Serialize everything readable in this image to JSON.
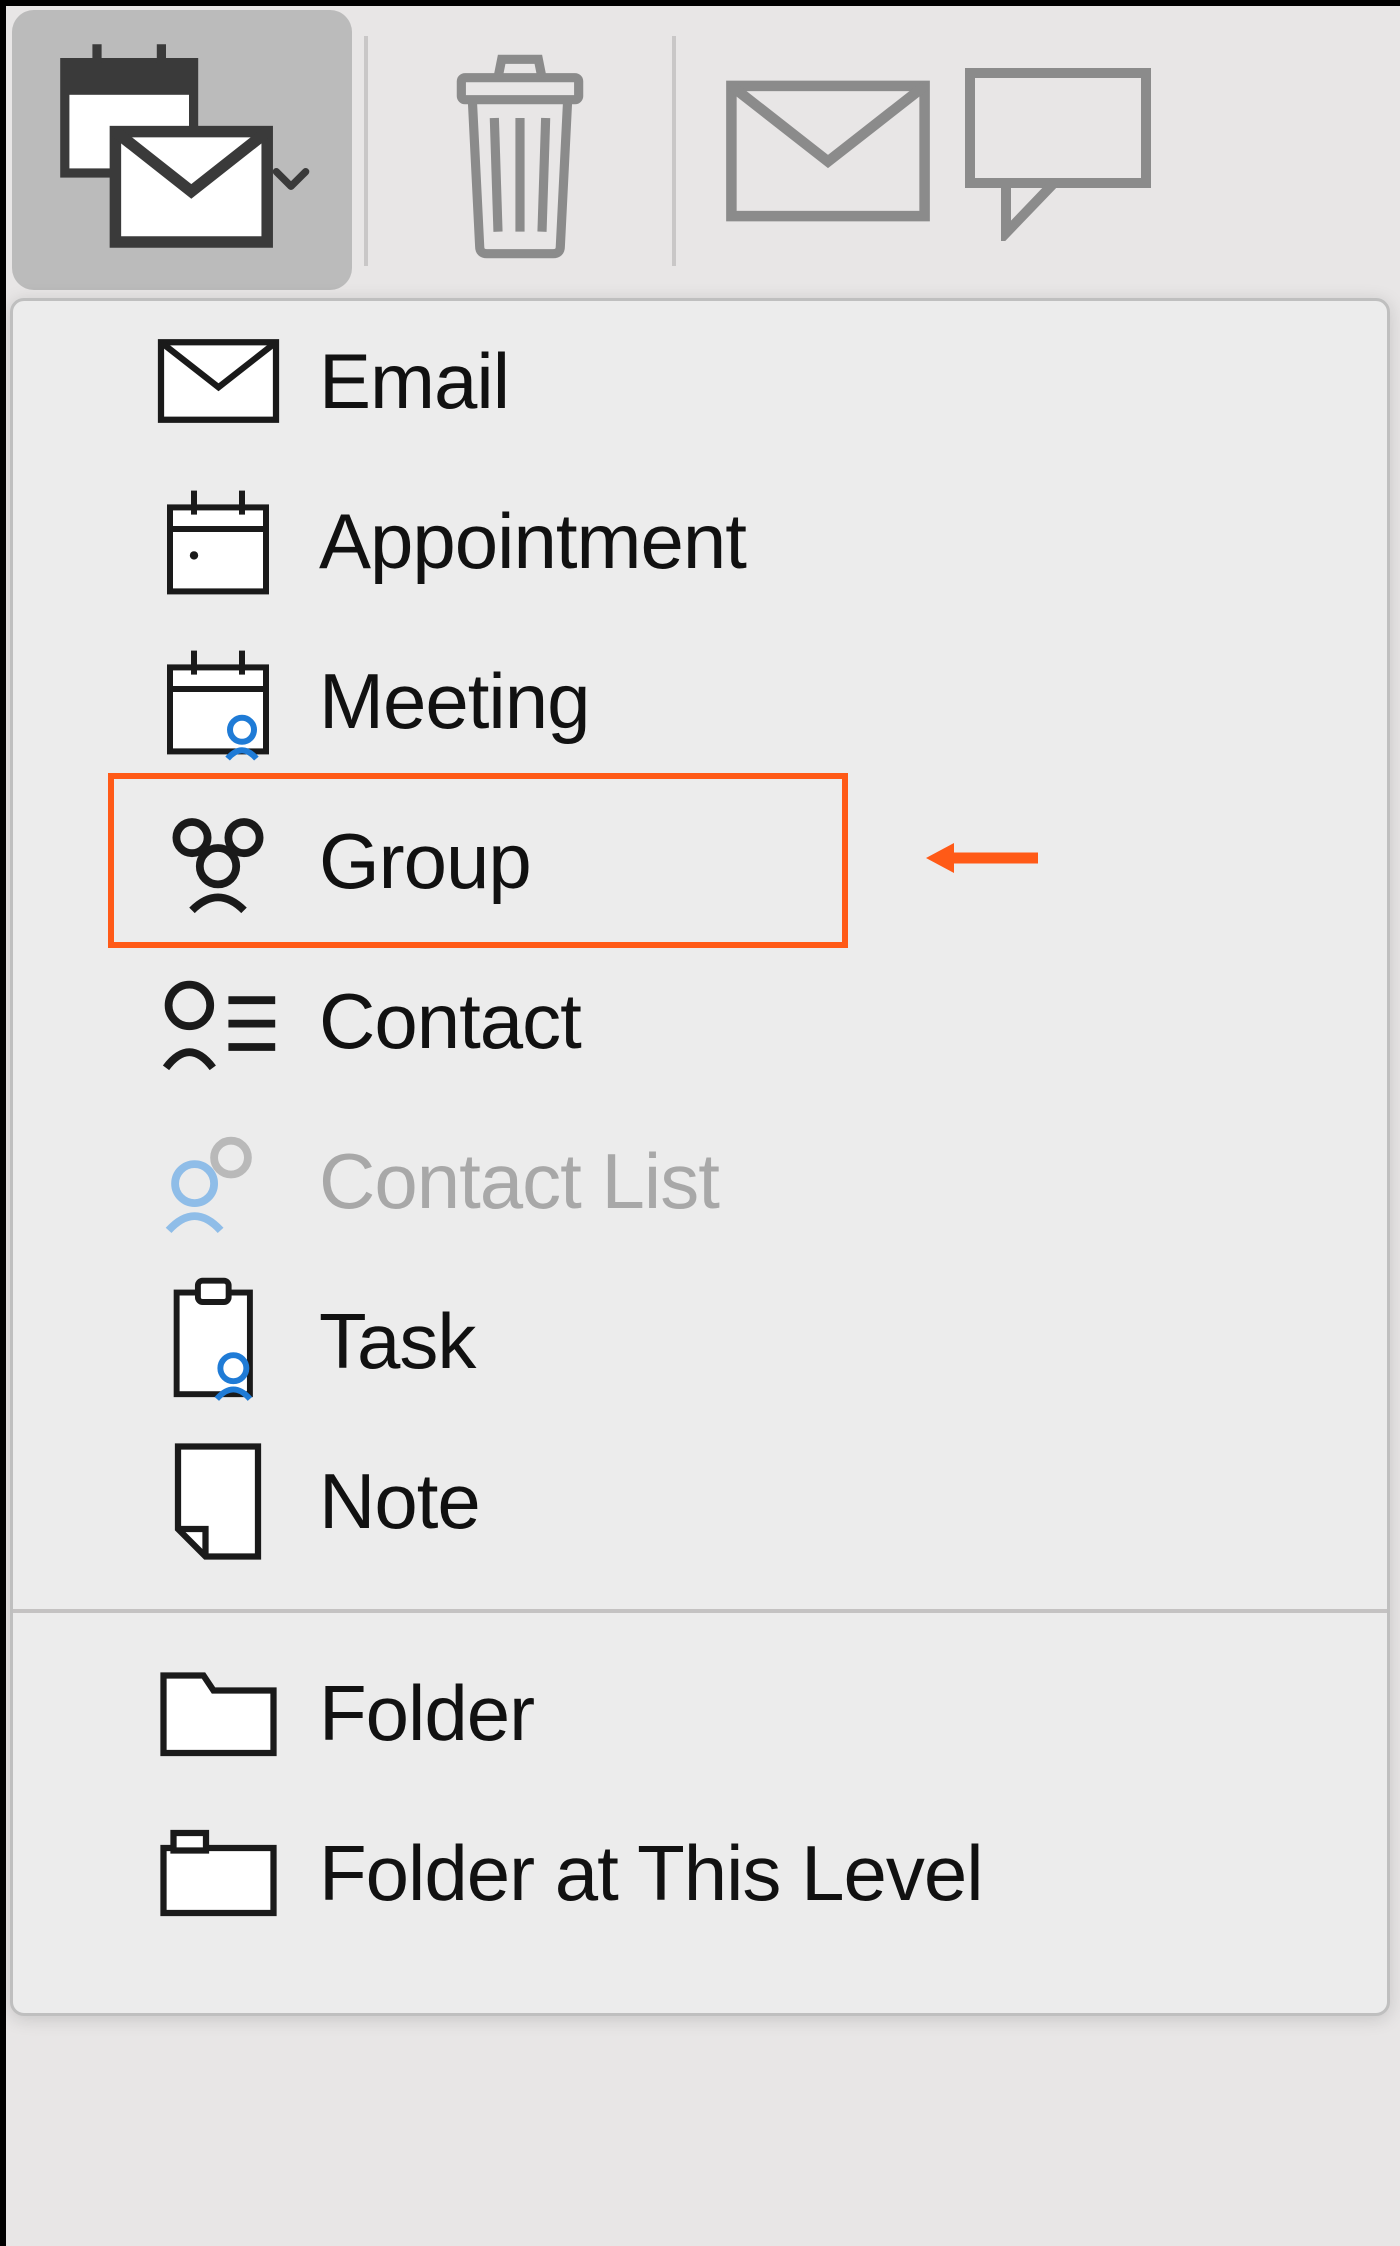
{
  "toolbar": {
    "new_button_name": "new-item-button",
    "delete_button_name": "delete-button",
    "mail_button_name": "mail-button",
    "reply_button_name": "reply-button"
  },
  "menu": {
    "items": [
      {
        "label": "Email",
        "icon": "mail-icon",
        "name": "menu-item-email",
        "disabled": false
      },
      {
        "label": "Appointment",
        "icon": "calendar-dot-icon",
        "name": "menu-item-appointment",
        "disabled": false
      },
      {
        "label": "Meeting",
        "icon": "calendar-person-icon",
        "name": "menu-item-meeting",
        "disabled": false
      },
      {
        "label": "Group",
        "icon": "people-icon",
        "name": "menu-item-group",
        "disabled": false,
        "highlighted": true
      },
      {
        "label": "Contact",
        "icon": "contact-icon",
        "name": "menu-item-contact",
        "disabled": false
      },
      {
        "label": "Contact List",
        "icon": "people-light-icon",
        "name": "menu-item-contact-list",
        "disabled": true
      },
      {
        "label": "Task",
        "icon": "clipboard-person-icon",
        "name": "menu-item-task",
        "disabled": false
      },
      {
        "label": "Note",
        "icon": "note-icon",
        "name": "menu-item-note",
        "disabled": false
      }
    ],
    "secondary_items": [
      {
        "label": "Folder",
        "icon": "folder-icon",
        "name": "menu-item-folder"
      },
      {
        "label": "Folder at This Level",
        "icon": "folder-tab-icon",
        "name": "menu-item-folder-level"
      }
    ]
  },
  "colors": {
    "highlight": "#ff5a17",
    "accent": "#1f7bd6"
  }
}
